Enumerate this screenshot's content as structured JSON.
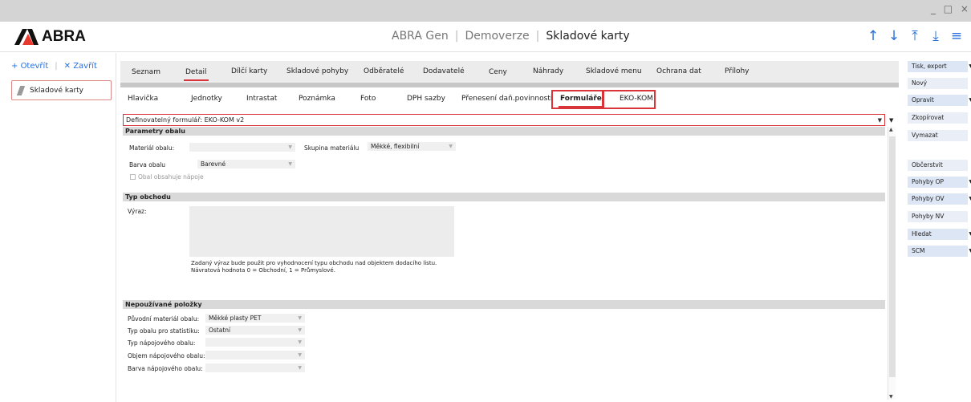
{
  "window": {
    "controls": "_ □ ×"
  },
  "appbar": {
    "logo": "ABRA",
    "title_app": "ABRA Gen",
    "title_company": "Demoverze",
    "title_agenda": "Skladové karty"
  },
  "left": {
    "open_label": "Otevřít",
    "close_label": "Zavřít",
    "documents": [
      {
        "label": "Skladové karty"
      }
    ]
  },
  "tabs_main": [
    "Seznam",
    "Detail",
    "Dílčí karty",
    "Skladové pohyby",
    "Odběratelé",
    "Dodavatelé",
    "Ceny",
    "Náhrady",
    "Skladové menu",
    "Ochrana dat",
    "Přílohy"
  ],
  "tabs_detail": [
    "Hlavička",
    "Jednotky",
    "Intrastat",
    "Poznámka",
    "Foto",
    "DPH sazby",
    "Přenesení daň.povinnosti",
    "Formuláře",
    "EKO-KOM"
  ],
  "form": {
    "definable_label": "Definovatelný formulář:",
    "definable_value": "EKO-KOM v2",
    "section1": "Parametry obalu",
    "material_label": "Materiál obalu:",
    "material_value": "",
    "group_label": "Skupina materiálu",
    "group_value": "Měkké, flexibilní",
    "color_label": "Barva obalu",
    "color_value": "Barevné",
    "drinks_label": "Obal obsahuje nápoje",
    "section2": "Typ obchodu",
    "expr_label": "Výraz:",
    "note_line1": "Zadaný výraz bude použit pro vyhodnocení typu obchodu nad objektem dodacího listu.",
    "note_line2": "Návratová hodnota 0 = Obchodní, 1 = Průmyslové.",
    "section3": "Nepoužívané položky",
    "unused": [
      {
        "label": "Původní materiál obalu:",
        "value": "Měkké plasty PET"
      },
      {
        "label": "Typ obalu pro statistiku:",
        "value": "Ostatní"
      },
      {
        "label": "Typ nápojového obalu:",
        "value": ""
      },
      {
        "label": "Objem nápojového obalu:",
        "value": ""
      },
      {
        "label": "Barva nápojového obalu:",
        "value": ""
      }
    ]
  },
  "right": {
    "buttons": [
      "Tisk, export",
      "Nový",
      "Opravit",
      "Zkopírovat",
      "Vymazat",
      "Občerstvit",
      "Pohyby OP",
      "Pohyby OV",
      "Pohyby NV",
      "Hledat",
      "SCM"
    ]
  }
}
